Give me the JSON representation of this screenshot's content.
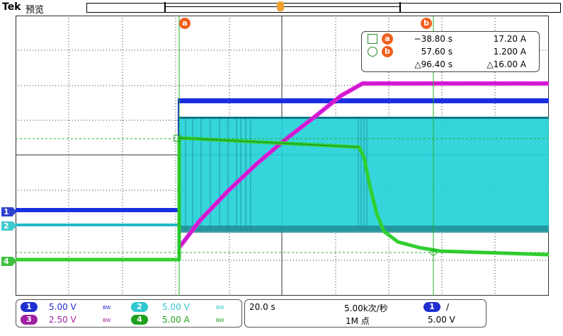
{
  "header": {
    "brand": "Tek",
    "mode": "预览"
  },
  "cursors": {
    "a_label": "a",
    "b_label": "b"
  },
  "readout": {
    "row_a": {
      "time": "−38.80 s",
      "value": "17.20 A"
    },
    "row_b": {
      "time": "57.60 s",
      "value": "1.200 A"
    },
    "delta": {
      "time": "△96.40 s",
      "value": "△16.00 A"
    }
  },
  "channel_markers": [
    {
      "label": "1",
      "color": "#3040d0"
    },
    {
      "label": "2",
      "color": "#40c8d0"
    },
    {
      "label": "4",
      "color": "#40c040"
    }
  ],
  "channels": {
    "ch1": {
      "label": "1",
      "scale": "5.00 V",
      "bw": "BW",
      "color": "#2030d0"
    },
    "ch2": {
      "label": "2",
      "scale": "5.00 V",
      "bw": "BW",
      "color": "#30c8d0"
    },
    "ch3": {
      "label": "3",
      "scale": "2.50 V",
      "bw": "BW",
      "color": "#a020a0"
    },
    "ch4": {
      "label": "4",
      "scale": "5.00 A",
      "bw": "BW",
      "color": "#20a020"
    }
  },
  "timebase": {
    "scale": "20.0 s",
    "sample_rate": "5.00k次/秒",
    "record_length": "1M 点",
    "trigger_channel": "1",
    "trigger_slope": "/",
    "trigger_level": "5.00 V"
  },
  "colors": {
    "ch1": "#1a2ee0",
    "ch2": "#20d0d8",
    "ch3": "#e020e0",
    "ch4": "#30d030",
    "cursor": "#20b020",
    "grid": "#303030"
  }
}
